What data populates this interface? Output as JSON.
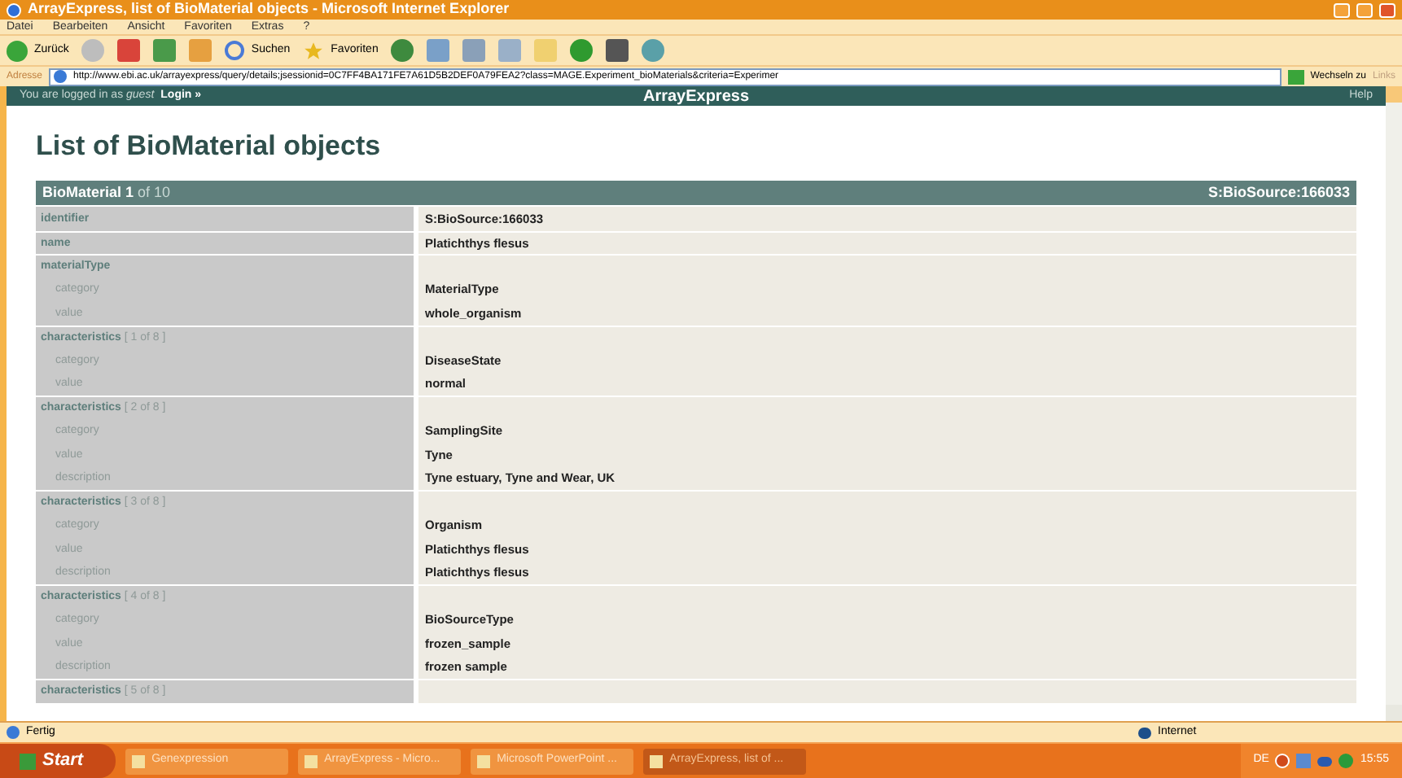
{
  "window": {
    "title": "ArrayExpress, list of BioMaterial objects - Microsoft Internet Explorer"
  },
  "menu": [
    "Datei",
    "Bearbeiten",
    "Ansicht",
    "Favoriten",
    "Extras",
    "?"
  ],
  "toolbar": {
    "back": "Zurück",
    "search": "Suchen",
    "favorites": "Favoriten"
  },
  "address": {
    "label": "Adresse",
    "url": "http://www.ebi.ac.uk/arrayexpress/query/details;jsessionid=0C7FF4BA171FE7A61D5B2DEF0A79FEA2?class=MAGE.Experiment_bioMaterials&criteria=Experimer",
    "go": "Wechseln zu",
    "links": "Links"
  },
  "site_bar": {
    "login_text": "You are logged in as *guest*",
    "login": "Login »",
    "title": "ArrayExpress",
    "help": "Help"
  },
  "heading": "List of BioMaterial objects",
  "table": {
    "title": "BioMaterial 1",
    "count": "of 10",
    "id": "S:BioSource:166033",
    "rows": [
      {
        "kind": "field",
        "label": "identifier",
        "value": "S:BioSource:166033"
      },
      {
        "kind": "field",
        "label": "name",
        "value": "Platichthys flesus"
      },
      {
        "kind": "group",
        "label": "materialType"
      },
      {
        "kind": "sub",
        "label": "category",
        "value": "MaterialType"
      },
      {
        "kind": "sub",
        "label": "value",
        "value": "whole_organism"
      },
      {
        "kind": "group",
        "label": "characteristics",
        "suffix": "[ 1 of 8 ]"
      },
      {
        "kind": "sub",
        "label": "category",
        "value": "DiseaseState"
      },
      {
        "kind": "sub",
        "label": "value",
        "value": "normal"
      },
      {
        "kind": "group",
        "label": "characteristics",
        "suffix": "[ 2 of 8 ]"
      },
      {
        "kind": "sub",
        "label": "category",
        "value": "SamplingSite"
      },
      {
        "kind": "sub",
        "label": "value",
        "value": "Tyne"
      },
      {
        "kind": "sub",
        "label": "description",
        "value": "Tyne estuary, Tyne and Wear, UK"
      },
      {
        "kind": "group",
        "label": "characteristics",
        "suffix": "[ 3 of 8 ]"
      },
      {
        "kind": "sub",
        "label": "category",
        "value": "Organism"
      },
      {
        "kind": "sub",
        "label": "value",
        "value": "Platichthys flesus"
      },
      {
        "kind": "sub",
        "label": "description",
        "value": "Platichthys flesus"
      },
      {
        "kind": "group",
        "label": "characteristics",
        "suffix": "[ 4 of 8 ]"
      },
      {
        "kind": "sub",
        "label": "category",
        "value": "BioSourceType"
      },
      {
        "kind": "sub",
        "label": "value",
        "value": "frozen_sample"
      },
      {
        "kind": "sub",
        "label": "description",
        "value": "frozen sample"
      },
      {
        "kind": "group",
        "label": "characteristics",
        "suffix": "[ 5 of 8 ]"
      }
    ]
  },
  "status_bar": {
    "text": "Fertig",
    "zone": "Internet"
  },
  "taskbar": {
    "start": "Start",
    "tasks": [
      {
        "label": "Genexpression",
        "selected": false
      },
      {
        "label": "ArrayExpress - Micro...",
        "selected": false
      },
      {
        "label": "Microsoft PowerPoint ...",
        "selected": false
      },
      {
        "label": "ArrayExpress, list of ...",
        "selected": true
      }
    ],
    "lang": "DE",
    "clock": "15:55"
  }
}
